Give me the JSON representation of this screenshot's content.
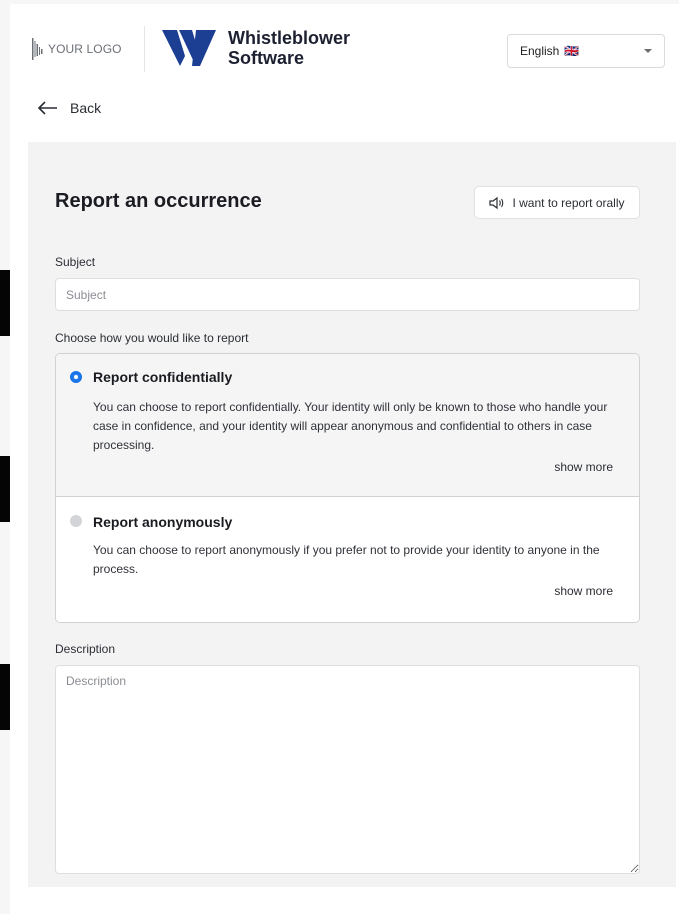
{
  "header": {
    "your_logo": "YOUR LOGO",
    "brand_line1": "Whistleblower",
    "brand_line2": "Software",
    "language": {
      "selected": "English",
      "flag": "🇬🇧"
    }
  },
  "nav": {
    "back_label": "Back"
  },
  "form": {
    "title": "Report an occurrence",
    "oral_button": "I want to report orally",
    "subject": {
      "label": "Subject",
      "placeholder": "Subject",
      "value": ""
    },
    "choose_label": "Choose how you would like to report",
    "options": [
      {
        "title": "Report confidentially",
        "description": "You can choose to report confidentially. Your identity will only be known to those who handle your case in confidence, and your identity will appear anonymous and confidential to others in case processing.",
        "show_more": "show more",
        "selected": true
      },
      {
        "title": "Report anonymously",
        "description": "You can choose to report anonymously if you prefer not to provide your identity to anyone in the process.",
        "show_more": "show more",
        "selected": false
      }
    ],
    "description": {
      "label": "Description",
      "placeholder": "Description",
      "value": ""
    }
  },
  "colors": {
    "accent": "#1a73e8",
    "brand": "#1c3f94",
    "panel_bg": "#f3f3f4"
  }
}
